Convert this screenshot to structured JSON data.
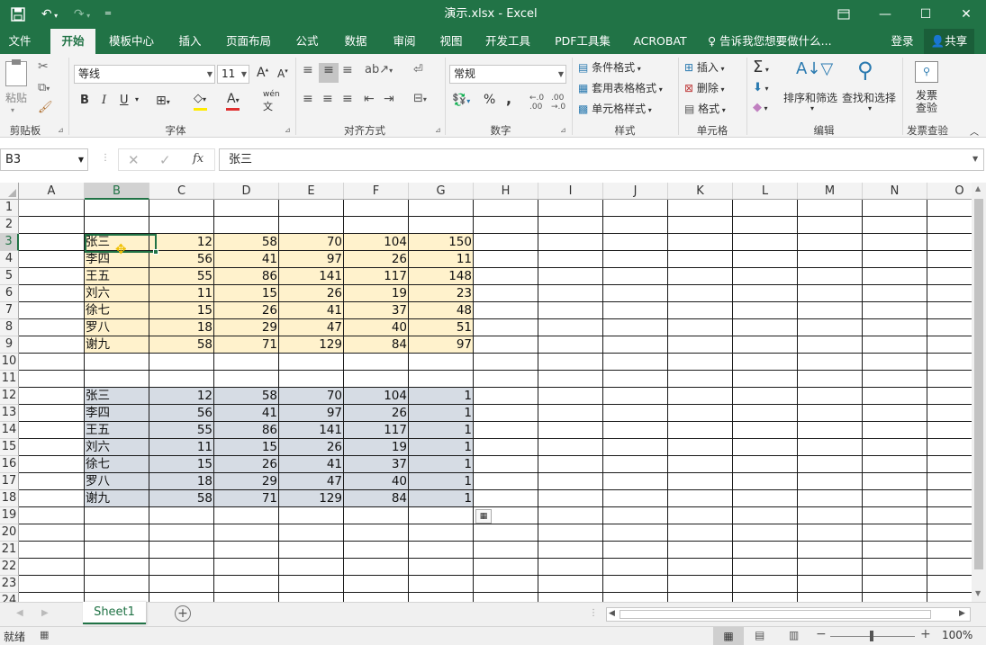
{
  "title": "演示.xlsx - Excel",
  "quick_access": {
    "save": "save-icon",
    "undo": "undo-icon",
    "redo": "redo-icon"
  },
  "window_controls": {
    "restore_ribbon": "ribbon-display-icon",
    "minimize": "—",
    "maximize": "☐",
    "close": "✕"
  },
  "tabs": [
    "文件",
    "开始",
    "模板中心",
    "插入",
    "页面布局",
    "公式",
    "数据",
    "审阅",
    "视图",
    "开发工具",
    "PDF工具集",
    "ACROBAT"
  ],
  "active_tab": "开始",
  "tell_me": "告诉我您想要做什么...",
  "login": "登录",
  "share": "共享",
  "ribbon": {
    "clipboard": {
      "label": "剪贴板",
      "paste": "粘贴"
    },
    "font": {
      "label": "字体",
      "name": "等线",
      "size": "11",
      "bold": "B",
      "italic": "I",
      "underline": "U",
      "grow": "A",
      "shrink": "A",
      "phonetic": "wén"
    },
    "alignment": {
      "label": "对齐方式"
    },
    "number": {
      "label": "数字",
      "format": "常规",
      "percent": "%",
      "comma": ","
    },
    "styles": {
      "label": "样式",
      "conditional": "条件格式",
      "table": "套用表格格式",
      "cell": "单元格样式"
    },
    "cells": {
      "label": "单元格",
      "insert": "插入",
      "delete": "删除",
      "format": "格式"
    },
    "editing": {
      "label": "编辑",
      "sort": "排序和筛选",
      "find": "查找和选择"
    },
    "invoice": {
      "label": "发票查验",
      "button_line1": "发票",
      "button_line2": "查验"
    }
  },
  "formula_bar": {
    "name_box": "B3",
    "fx": "fx",
    "value": "张三"
  },
  "columns": [
    "A",
    "B",
    "C",
    "D",
    "E",
    "F",
    "G",
    "H",
    "I",
    "J",
    "K",
    "L",
    "M",
    "N",
    "O"
  ],
  "rows": [
    "1",
    "2",
    "3",
    "4",
    "5",
    "6",
    "7",
    "8",
    "9",
    "10",
    "11",
    "12",
    "13",
    "14",
    "15",
    "16",
    "17",
    "18",
    "19",
    "20",
    "21",
    "22",
    "23",
    "24"
  ],
  "table1": [
    [
      "张三",
      12,
      58,
      70,
      104,
      150
    ],
    [
      "李四",
      56,
      41,
      97,
      26,
      11
    ],
    [
      "王五",
      55,
      86,
      141,
      117,
      148
    ],
    [
      "刘六",
      11,
      15,
      26,
      19,
      23
    ],
    [
      "徐七",
      15,
      26,
      41,
      37,
      48
    ],
    [
      "罗八",
      18,
      29,
      47,
      40,
      51
    ],
    [
      "谢九",
      58,
      71,
      129,
      84,
      97
    ]
  ],
  "table2": [
    [
      "张三",
      12,
      58,
      70,
      104,
      1
    ],
    [
      "李四",
      56,
      41,
      97,
      26,
      1
    ],
    [
      "王五",
      55,
      86,
      141,
      117,
      1
    ],
    [
      "刘六",
      11,
      15,
      26,
      19,
      1
    ],
    [
      "徐七",
      15,
      26,
      41,
      37,
      1
    ],
    [
      "罗八",
      18,
      29,
      47,
      40,
      1
    ],
    [
      "谢九",
      58,
      71,
      129,
      84,
      1
    ]
  ],
  "sheet_tab": "Sheet1",
  "status": {
    "ready": "就绪",
    "zoom": "100%"
  },
  "colors": {
    "excel_green": "#217346",
    "fill_yellow": "#fff2cc",
    "fill_blue": "#d6dce4"
  }
}
